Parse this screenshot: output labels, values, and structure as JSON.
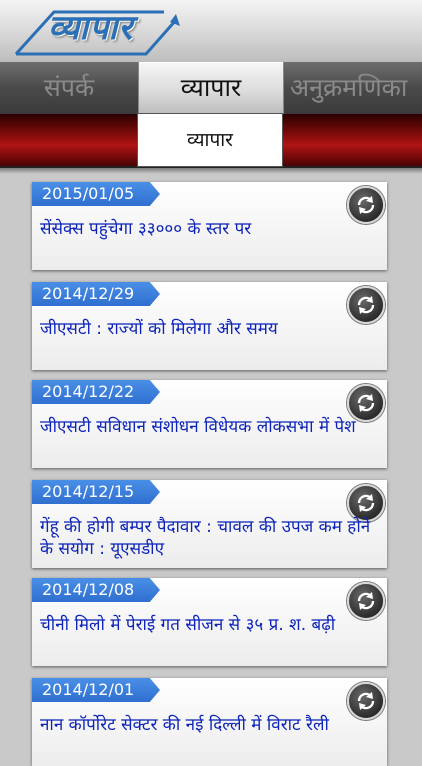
{
  "app": {
    "logo_text": "व्यापार"
  },
  "tabs": [
    {
      "label": "संपर्क"
    },
    {
      "label": "व्यापार"
    },
    {
      "label": "अनुक्रमणिका"
    }
  ],
  "section": {
    "label": "व्यापार"
  },
  "news": [
    {
      "date": "2015/01/05",
      "headline": "सेंसेक्स पहुंचेगा ३३००० के स्तर पर"
    },
    {
      "date": "2014/12/29",
      "headline": "जीएसटी : राज्यों को मिलेगा और समय"
    },
    {
      "date": "2014/12/22",
      "headline": "जीएसटी सविधान संशोधन विधेयक लोकसभा में पेश"
    },
    {
      "date": "2014/12/15",
      "headline": "गेंहू की होगी बम्पर पैदावार : चावल की उपज कम होने के सयोग : यूएसडीए"
    },
    {
      "date": "2014/12/08",
      "headline": "चीनी मिलो में पेराई गत सीजन से ३५ प्र. श. बढ़ी"
    },
    {
      "date": "2014/12/01",
      "headline": "नान कॉर्पोरेट सेक्टर की नई दिल्ली में विराट रैली"
    }
  ],
  "colors": {
    "accent": "#2f6fd0",
    "headline": "#0e24b8",
    "band": "#9e1010"
  }
}
